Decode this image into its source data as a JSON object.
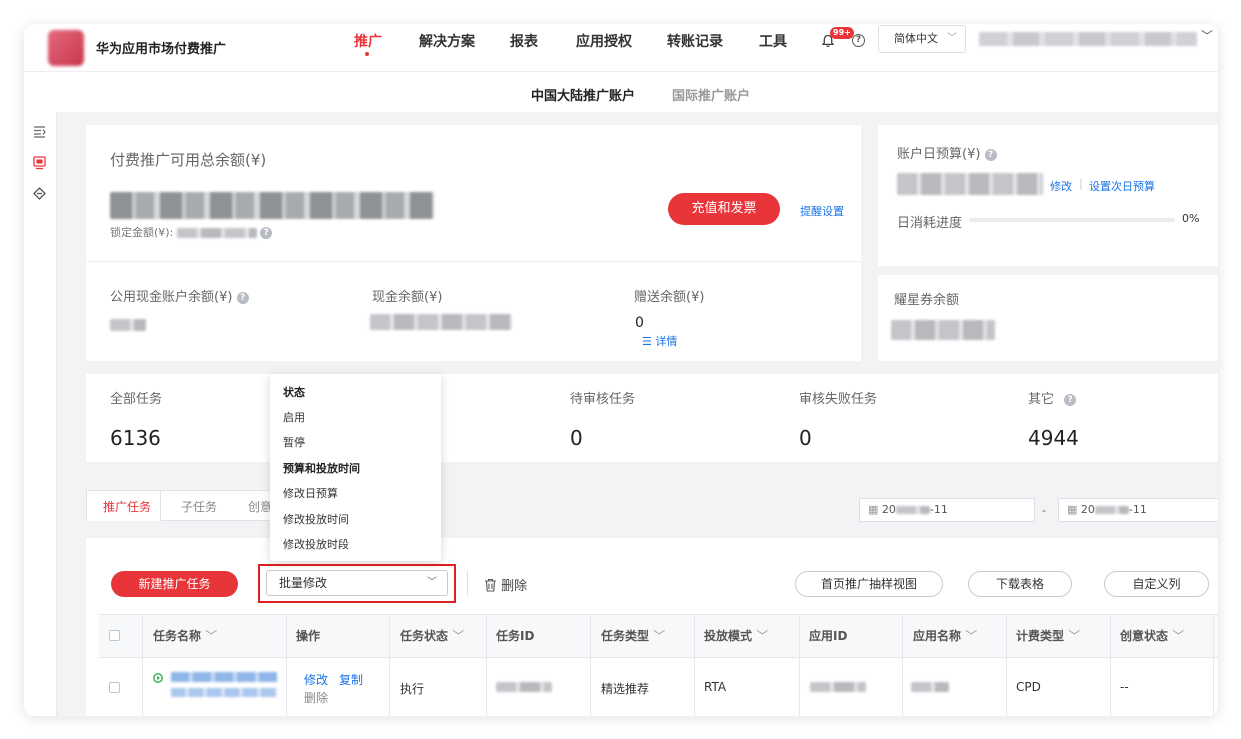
{
  "header": {
    "brand": "华为应用市场付费推广",
    "nav": [
      "推广",
      "解决方案",
      "报表",
      "应用授权",
      "转账记录",
      "工具"
    ],
    "badge": "99+",
    "language": "简体中文"
  },
  "subnav": {
    "tabs": [
      "中国大陆推广账户",
      "国际推广账户"
    ]
  },
  "balance": {
    "title": "付费推广可用总余额(¥)",
    "locked_label": "锁定金额(¥):",
    "recharge_button": "充值和发票",
    "reminder_link": "提醒设置",
    "public_cash_label": "公用现金账户余额(¥)",
    "cash_label": "现金余额(¥)",
    "gift_label": "赠送余额(¥)",
    "gift_value": "0",
    "detail_link": "详情"
  },
  "budget": {
    "title": "账户日预算(¥)",
    "modify_link": "修改",
    "next_day_link": "设置次日预算",
    "progress_label": "日消耗进度",
    "progress_value": "0%",
    "progress_fraction": 0
  },
  "coupon": {
    "label": "耀星券余额"
  },
  "stats": {
    "all_label": "全部任务",
    "all_value": "6136",
    "pending_label": "待审核任务",
    "pending_value": "0",
    "failed_label": "审核失败任务",
    "failed_value": "0",
    "other_label": "其它",
    "other_value": "4944"
  },
  "tabs": [
    "推广任务",
    "子任务",
    "创意"
  ],
  "dates": {
    "start": "20",
    "start_suffix": "-11",
    "separator": "-",
    "end": "20",
    "end_suffix": "-11"
  },
  "toolbar": {
    "new_task": "新建推广任务",
    "batch_modify": "批量修改",
    "delete": "删除",
    "sample_view": "首页推广抽样视图",
    "download": "下载表格",
    "custom_columns": "自定义列"
  },
  "dropdown": {
    "status_heading": "状态",
    "enable": "启用",
    "pause": "暂停",
    "budget_heading": "预算和投放时间",
    "modify_daily_budget": "修改日预算",
    "modify_time": "修改投放时间",
    "modify_period": "修改投放时段"
  },
  "table": {
    "columns": [
      "任务名称",
      "操作",
      "任务状态",
      "任务ID",
      "任务类型",
      "投放模式",
      "应用ID",
      "应用名称",
      "计费类型",
      "创意状态"
    ],
    "row": {
      "actions": [
        "修改",
        "复制",
        "删除"
      ],
      "status": "执行",
      "type": "精选推荐",
      "mode": "RTA",
      "billing": "CPD",
      "creative_status": "--"
    }
  }
}
